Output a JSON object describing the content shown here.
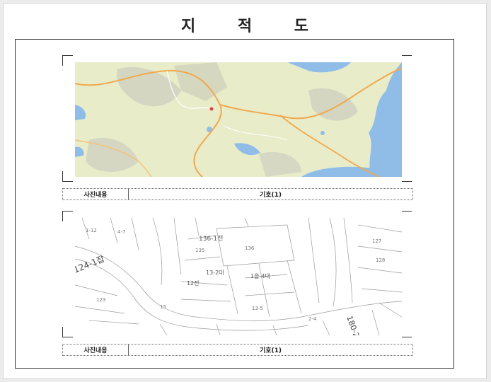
{
  "document": {
    "title": "지 적 도"
  },
  "panels": [
    {
      "kind": "map",
      "caption_label": "사진내용",
      "caption_value": "기호(1)",
      "colors": {
        "land": "#e9ecc9",
        "water": "#8fbde8",
        "road": "#f0a94e",
        "relief": "#d2d4c0"
      }
    },
    {
      "kind": "cadastral",
      "caption_label": "사진내용",
      "caption_value": "기호(1)",
      "lot_labels": [
        "136-1전",
        "124-1잡",
        "13-2대",
        "12전",
        "1을-4대",
        "180-2"
      ]
    }
  ]
}
